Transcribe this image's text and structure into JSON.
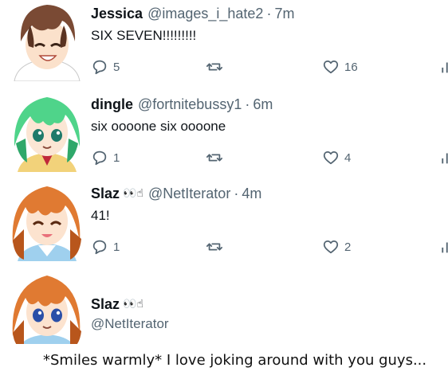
{
  "posts": [
    {
      "name": "Jessica",
      "emoji": "",
      "handle": "@images_i_hate2",
      "separator": "·",
      "time": "7m",
      "text": "SIX SEVEN!!!!!!!!!",
      "replies": "5",
      "reposts": "",
      "likes": "16",
      "avatar": {
        "hair": "#7a4a34",
        "hair_dark": "#5a3322",
        "eyes": "closed",
        "outfit": "#ffffff"
      }
    },
    {
      "name": "dingle",
      "emoji": "",
      "handle": "@fortnitebussy1",
      "separator": "·",
      "time": "6m",
      "text": "six oooone six oooone",
      "replies": "1",
      "reposts": "",
      "likes": "4",
      "avatar": {
        "hair": "#4fd48a",
        "hair_dark": "#2fa86a",
        "eyes": "#1e7a6a",
        "outfit": "#f2d27a"
      }
    },
    {
      "name": "Slaz",
      "emoji": "👀☝",
      "handle": "@NetIterator",
      "separator": "·",
      "time": "4m",
      "text": "41!",
      "replies": "1",
      "reposts": "",
      "likes": "2",
      "avatar": {
        "hair": "#e07a32",
        "hair_dark": "#b8561c",
        "eyes": "closed",
        "outfit": "#9fd0ee"
      }
    }
  ],
  "card": {
    "name": "Slaz",
    "emoji": "👀☝",
    "handle": "@NetIterator",
    "avatar": {
      "hair": "#e07a32",
      "hair_dark": "#b8561c",
      "eyes": "#2a4fa8",
      "outfit": "#9fd0ee"
    }
  },
  "caption": "*Smiles warmly* I love joking around with you guys...",
  "colors": {
    "text": "#0f1419",
    "muted": "#536471",
    "background": "#ffffff"
  },
  "icons": {
    "reply": "speech-bubble-icon",
    "repost": "repost-arrows-icon",
    "like": "heart-icon",
    "views": "bar-chart-icon"
  }
}
